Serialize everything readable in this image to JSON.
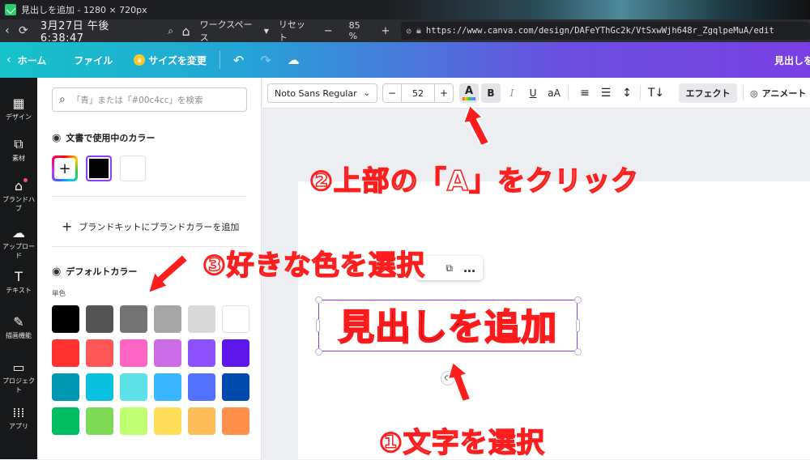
{
  "window": {
    "title": "見出しを追加 - 1280 × 720px"
  },
  "browser": {
    "clock": "3月27日 午後 6:38:47",
    "workspace_label": "ワークスペース",
    "reset_label": "リセット",
    "zoom_minus": "−",
    "zoom_percent": "85 %",
    "zoom_plus": "+",
    "url": "https://www.canva.com/design/DAFeYThGc2k/VtSxwWjh648r_ZgqlpeMuA/edit"
  },
  "canva_bar": {
    "home_label": "ホーム",
    "file_label": "ファイル",
    "resize_label": "サイズを変更",
    "right_title_partial": "見出しを"
  },
  "rail": {
    "items": [
      {
        "label": "デザイン",
        "icon": "design-icon",
        "glyph": "▦"
      },
      {
        "label": "素材",
        "icon": "elements-icon",
        "glyph": "⧉"
      },
      {
        "label": "ブランドハブ",
        "icon": "brand-hub-icon",
        "glyph": "⌂"
      },
      {
        "label": "アップロード",
        "icon": "upload-icon",
        "glyph": "☁"
      },
      {
        "label": "テキスト",
        "icon": "text-icon",
        "glyph": "T"
      },
      {
        "label": "描画機能",
        "icon": "draw-icon",
        "glyph": "✎"
      },
      {
        "label": "プロジェクト",
        "icon": "folder-icon",
        "glyph": "▭"
      },
      {
        "label": "アプリ",
        "icon": "apps-icon",
        "glyph": "⁞⁞⁞"
      }
    ]
  },
  "panel": {
    "search_placeholder": "「青」または「#00c4cc」を検索",
    "doc_colors_title": "文書で使用中のカラー",
    "doc_colors": [
      "#000000",
      "#ffffff"
    ],
    "brand_kit_label": "ブランドキットにブランドカラーを追加",
    "default_colors_title": "デフォルトカラー",
    "solid_label": "単色",
    "default_colors": [
      [
        "#000000",
        "#545454",
        "#737373",
        "#a6a6a6",
        "#d9d9d9",
        "#ffffff"
      ],
      [
        "#ff3131",
        "#ff5757",
        "#ff66c4",
        "#cb6ce6",
        "#8c52ff",
        "#5e17eb"
      ],
      [
        "#0097b2",
        "#0cc0df",
        "#5ce1e6",
        "#38b6ff",
        "#5271ff",
        "#004aad"
      ],
      [
        "#00bf63",
        "#7ed957",
        "#c1ff72",
        "#ffde59",
        "#ffbd59",
        "#ff914d"
      ]
    ]
  },
  "toolbar": {
    "font_name": "Noto Sans Regular",
    "font_size": "52",
    "minus": "−",
    "plus": "+",
    "text_color_glyph": "A",
    "bold_glyph": "B",
    "italic_glyph": "I",
    "underline_glyph": "U",
    "case_glyph": "aA",
    "effect_label": "エフェクト",
    "animate_label": "アニメート"
  },
  "canvas": {
    "headline": "見出しを追加",
    "minibar_more": "…"
  },
  "annotations": {
    "step1": "①文字を選択",
    "step2": "②上部の「A」をクリック",
    "step3": "③好きな色を選択"
  },
  "colors": {
    "selection": "#8b3dff",
    "annotation_stroke": "#ff1e1e",
    "headline_stroke": "#ff1b1b"
  }
}
